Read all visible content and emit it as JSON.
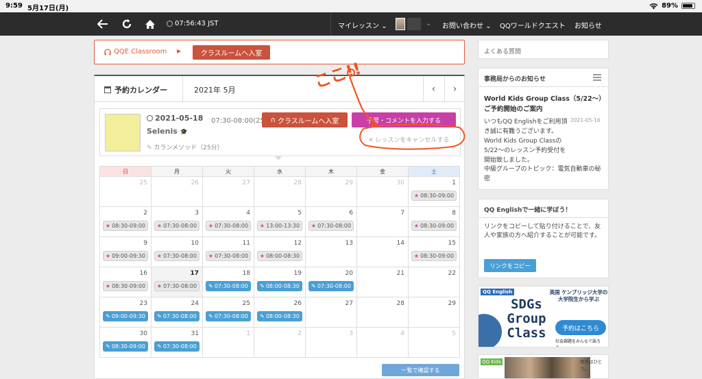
{
  "statusbar": {
    "time": "9:59",
    "date": "5月17日(月)",
    "battery": "89%",
    "battery_level": 0.89,
    "icons": [
      "wifi-icon",
      "battery-icon"
    ]
  },
  "nav": {
    "clock": "07:56:43 JST",
    "my_lesson": "マイレッスン",
    "contact": "お問い合わせ",
    "quest": "QQワールドクエスト",
    "notice": "お知らせ",
    "icons": [
      "back-icon",
      "reload-icon",
      "home-icon",
      "clock-icon"
    ]
  },
  "classroom": {
    "label": "QQE Classroom",
    "enter_button": "クラスルームへ入室"
  },
  "calendar": {
    "title": "予約カレンダー",
    "month": "2021年 5月",
    "prev": "‹",
    "next": "›",
    "lesson": {
      "date": "2021-05-18",
      "time": "07:30-08:00(25分)",
      "teacher": "Selenis",
      "method": "カランメソッド（25分）",
      "enter_button": "クラスルームへ入室",
      "comment_button": "予習・コメントを入力する",
      "cancel_link": "レッスンをキャンセルする"
    },
    "weekdays": [
      "日",
      "月",
      "火",
      "水",
      "木",
      "金",
      "土"
    ],
    "weeks": [
      [
        {
          "day": "25",
          "muted": true
        },
        {
          "day": "26",
          "muted": true
        },
        {
          "day": "27",
          "muted": true
        },
        {
          "day": "28",
          "muted": true
        },
        {
          "day": "29",
          "muted": true
        },
        {
          "day": "30",
          "muted": true
        },
        {
          "day": "1",
          "slot": "08:30-09:00",
          "state": "done"
        }
      ],
      [
        {
          "day": "2",
          "slot": "08:30-09:00",
          "state": "done"
        },
        {
          "day": "3",
          "slot": "07:30-08:00",
          "state": "done"
        },
        {
          "day": "4",
          "slot": "07:30-08:00",
          "state": "done"
        },
        {
          "day": "5",
          "slot": "13:00-13:30",
          "state": "done"
        },
        {
          "day": "6",
          "slot": "07:30-08:00",
          "state": "done"
        },
        {
          "day": "7"
        },
        {
          "day": "8",
          "slot": "08:30-09:00",
          "state": "done"
        }
      ],
      [
        {
          "day": "9",
          "slot": "09:00-09:30",
          "state": "done"
        },
        {
          "day": "10",
          "slot": "07:30-08:00",
          "state": "done"
        },
        {
          "day": "11",
          "slot": "07:30-08:00",
          "state": "done"
        },
        {
          "day": "12",
          "slot": "08:00-08:30",
          "state": "done"
        },
        {
          "day": "13"
        },
        {
          "day": "14"
        },
        {
          "day": "15",
          "slot": "08:30-09:00",
          "state": "done"
        }
      ],
      [
        {
          "day": "16",
          "slot": "08:30-09:00",
          "state": "done"
        },
        {
          "day": "17",
          "slot": "07:30-08:00",
          "state": "done",
          "today": true
        },
        {
          "day": "18",
          "slot": "07:30-08:00",
          "state": "booked"
        },
        {
          "day": "19",
          "slot": "08:00-08:30",
          "state": "booked"
        },
        {
          "day": "20",
          "slot": "07:30-08:00",
          "state": "booked"
        },
        {
          "day": "21"
        },
        {
          "day": "22"
        }
      ],
      [
        {
          "day": "23",
          "slot": "09:00-09:30",
          "state": "booked"
        },
        {
          "day": "24",
          "slot": "07:30-08:00",
          "state": "booked"
        },
        {
          "day": "25",
          "slot": "07:30-08:00",
          "state": "booked"
        },
        {
          "day": "26",
          "slot": "08:00-08:30",
          "state": "booked"
        },
        {
          "day": "27"
        },
        {
          "day": "28"
        },
        {
          "day": "29"
        }
      ],
      [
        {
          "day": "30",
          "slot": "08:30-09:00",
          "state": "booked"
        },
        {
          "day": "31",
          "slot": "07:30-08:00",
          "state": "booked"
        },
        {
          "day": "1",
          "muted": true
        },
        {
          "day": "2",
          "muted": true
        },
        {
          "day": "3",
          "muted": true
        },
        {
          "day": "4",
          "muted": true
        },
        {
          "day": "5",
          "muted": true
        }
      ]
    ],
    "list_button": "一覧で確認する"
  },
  "sidebar": {
    "faq": "よくある質問",
    "news_header": "事務局からのお知らせ",
    "news_title": "World Kids Group Class（5/22〜）ご予約開始のご案内",
    "news_date": "2021-05-16",
    "news_body": "いつもQQ Englishをご利用頂き誠に有難うございます。World Kids Group Classの5/22〜のレッスン予約受付を開始致しました。",
    "news_more": "中級グループのトピック：電気自動車の秘密",
    "invite_header": "QQ Englishで一緒に学ぼう！",
    "invite_text": "リンクをコピーして貼り付けることで、友人や家族の方へ紹介することが可能です。",
    "copy_button": "リンクをコピー"
  },
  "banner": {
    "logo": "QQ English",
    "sdgs": "SDGs Group Class",
    "side": "英国 ケンブリッジ大学の 大学院生から学ぶ",
    "button": "予約はこちら",
    "footer": "社会課題をみんなで語ろう。"
  },
  "banner2": {
    "logo": "QQ Kids",
    "text": "世界はひとつ。"
  },
  "annotation": {
    "text": "ここ!!",
    "color": "#e52"
  },
  "colors": {
    "nav_bg": "#2c2c2c",
    "accent_red": "#c9533d",
    "accent_pink": "#c93fa8",
    "booked_blue": "#4a9fd4"
  }
}
